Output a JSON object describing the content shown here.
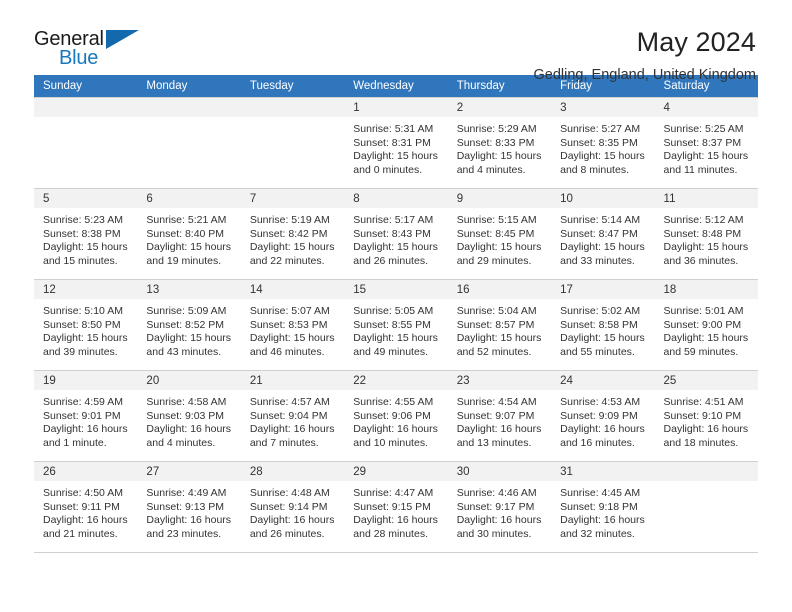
{
  "branding": {
    "logo_text_1": "General",
    "logo_text_2": "Blue",
    "triangle_color": "#1269ae",
    "blue_color": "#1878bd"
  },
  "header": {
    "title": "May 2024",
    "subtitle": "Gedling, England, United Kingdom",
    "header_bg": "#3076bd",
    "daynum_bg": "#f2f2f2"
  },
  "weekdays": [
    "Sunday",
    "Monday",
    "Tuesday",
    "Wednesday",
    "Thursday",
    "Friday",
    "Saturday"
  ],
  "labels": {
    "sunrise": "Sunrise:",
    "sunset": "Sunset:",
    "daylight": "Daylight:"
  },
  "weeks": [
    [
      {
        "day": "",
        "empty": true
      },
      {
        "day": "",
        "empty": true
      },
      {
        "day": "",
        "empty": true
      },
      {
        "day": "1",
        "sunrise": "Sunrise: 5:31 AM",
        "sunset": "Sunset: 8:31 PM",
        "daylight_1": "Daylight: 15 hours",
        "daylight_2": "and 0 minutes."
      },
      {
        "day": "2",
        "sunrise": "Sunrise: 5:29 AM",
        "sunset": "Sunset: 8:33 PM",
        "daylight_1": "Daylight: 15 hours",
        "daylight_2": "and 4 minutes."
      },
      {
        "day": "3",
        "sunrise": "Sunrise: 5:27 AM",
        "sunset": "Sunset: 8:35 PM",
        "daylight_1": "Daylight: 15 hours",
        "daylight_2": "and 8 minutes."
      },
      {
        "day": "4",
        "sunrise": "Sunrise: 5:25 AM",
        "sunset": "Sunset: 8:37 PM",
        "daylight_1": "Daylight: 15 hours",
        "daylight_2": "and 11 minutes."
      }
    ],
    [
      {
        "day": "5",
        "sunrise": "Sunrise: 5:23 AM",
        "sunset": "Sunset: 8:38 PM",
        "daylight_1": "Daylight: 15 hours",
        "daylight_2": "and 15 minutes."
      },
      {
        "day": "6",
        "sunrise": "Sunrise: 5:21 AM",
        "sunset": "Sunset: 8:40 PM",
        "daylight_1": "Daylight: 15 hours",
        "daylight_2": "and 19 minutes."
      },
      {
        "day": "7",
        "sunrise": "Sunrise: 5:19 AM",
        "sunset": "Sunset: 8:42 PM",
        "daylight_1": "Daylight: 15 hours",
        "daylight_2": "and 22 minutes."
      },
      {
        "day": "8",
        "sunrise": "Sunrise: 5:17 AM",
        "sunset": "Sunset: 8:43 PM",
        "daylight_1": "Daylight: 15 hours",
        "daylight_2": "and 26 minutes."
      },
      {
        "day": "9",
        "sunrise": "Sunrise: 5:15 AM",
        "sunset": "Sunset: 8:45 PM",
        "daylight_1": "Daylight: 15 hours",
        "daylight_2": "and 29 minutes."
      },
      {
        "day": "10",
        "sunrise": "Sunrise: 5:14 AM",
        "sunset": "Sunset: 8:47 PM",
        "daylight_1": "Daylight: 15 hours",
        "daylight_2": "and 33 minutes."
      },
      {
        "day": "11",
        "sunrise": "Sunrise: 5:12 AM",
        "sunset": "Sunset: 8:48 PM",
        "daylight_1": "Daylight: 15 hours",
        "daylight_2": "and 36 minutes."
      }
    ],
    [
      {
        "day": "12",
        "sunrise": "Sunrise: 5:10 AM",
        "sunset": "Sunset: 8:50 PM",
        "daylight_1": "Daylight: 15 hours",
        "daylight_2": "and 39 minutes."
      },
      {
        "day": "13",
        "sunrise": "Sunrise: 5:09 AM",
        "sunset": "Sunset: 8:52 PM",
        "daylight_1": "Daylight: 15 hours",
        "daylight_2": "and 43 minutes."
      },
      {
        "day": "14",
        "sunrise": "Sunrise: 5:07 AM",
        "sunset": "Sunset: 8:53 PM",
        "daylight_1": "Daylight: 15 hours",
        "daylight_2": "and 46 minutes."
      },
      {
        "day": "15",
        "sunrise": "Sunrise: 5:05 AM",
        "sunset": "Sunset: 8:55 PM",
        "daylight_1": "Daylight: 15 hours",
        "daylight_2": "and 49 minutes."
      },
      {
        "day": "16",
        "sunrise": "Sunrise: 5:04 AM",
        "sunset": "Sunset: 8:57 PM",
        "daylight_1": "Daylight: 15 hours",
        "daylight_2": "and 52 minutes."
      },
      {
        "day": "17",
        "sunrise": "Sunrise: 5:02 AM",
        "sunset": "Sunset: 8:58 PM",
        "daylight_1": "Daylight: 15 hours",
        "daylight_2": "and 55 minutes."
      },
      {
        "day": "18",
        "sunrise": "Sunrise: 5:01 AM",
        "sunset": "Sunset: 9:00 PM",
        "daylight_1": "Daylight: 15 hours",
        "daylight_2": "and 59 minutes."
      }
    ],
    [
      {
        "day": "19",
        "sunrise": "Sunrise: 4:59 AM",
        "sunset": "Sunset: 9:01 PM",
        "daylight_1": "Daylight: 16 hours",
        "daylight_2": "and 1 minute."
      },
      {
        "day": "20",
        "sunrise": "Sunrise: 4:58 AM",
        "sunset": "Sunset: 9:03 PM",
        "daylight_1": "Daylight: 16 hours",
        "daylight_2": "and 4 minutes."
      },
      {
        "day": "21",
        "sunrise": "Sunrise: 4:57 AM",
        "sunset": "Sunset: 9:04 PM",
        "daylight_1": "Daylight: 16 hours",
        "daylight_2": "and 7 minutes."
      },
      {
        "day": "22",
        "sunrise": "Sunrise: 4:55 AM",
        "sunset": "Sunset: 9:06 PM",
        "daylight_1": "Daylight: 16 hours",
        "daylight_2": "and 10 minutes."
      },
      {
        "day": "23",
        "sunrise": "Sunrise: 4:54 AM",
        "sunset": "Sunset: 9:07 PM",
        "daylight_1": "Daylight: 16 hours",
        "daylight_2": "and 13 minutes."
      },
      {
        "day": "24",
        "sunrise": "Sunrise: 4:53 AM",
        "sunset": "Sunset: 9:09 PM",
        "daylight_1": "Daylight: 16 hours",
        "daylight_2": "and 16 minutes."
      },
      {
        "day": "25",
        "sunrise": "Sunrise: 4:51 AM",
        "sunset": "Sunset: 9:10 PM",
        "daylight_1": "Daylight: 16 hours",
        "daylight_2": "and 18 minutes."
      }
    ],
    [
      {
        "day": "26",
        "sunrise": "Sunrise: 4:50 AM",
        "sunset": "Sunset: 9:11 PM",
        "daylight_1": "Daylight: 16 hours",
        "daylight_2": "and 21 minutes."
      },
      {
        "day": "27",
        "sunrise": "Sunrise: 4:49 AM",
        "sunset": "Sunset: 9:13 PM",
        "daylight_1": "Daylight: 16 hours",
        "daylight_2": "and 23 minutes."
      },
      {
        "day": "28",
        "sunrise": "Sunrise: 4:48 AM",
        "sunset": "Sunset: 9:14 PM",
        "daylight_1": "Daylight: 16 hours",
        "daylight_2": "and 26 minutes."
      },
      {
        "day": "29",
        "sunrise": "Sunrise: 4:47 AM",
        "sunset": "Sunset: 9:15 PM",
        "daylight_1": "Daylight: 16 hours",
        "daylight_2": "and 28 minutes."
      },
      {
        "day": "30",
        "sunrise": "Sunrise: 4:46 AM",
        "sunset": "Sunset: 9:17 PM",
        "daylight_1": "Daylight: 16 hours",
        "daylight_2": "and 30 minutes."
      },
      {
        "day": "31",
        "sunrise": "Sunrise: 4:45 AM",
        "sunset": "Sunset: 9:18 PM",
        "daylight_1": "Daylight: 16 hours",
        "daylight_2": "and 32 minutes."
      },
      {
        "day": "",
        "empty": true
      }
    ]
  ]
}
